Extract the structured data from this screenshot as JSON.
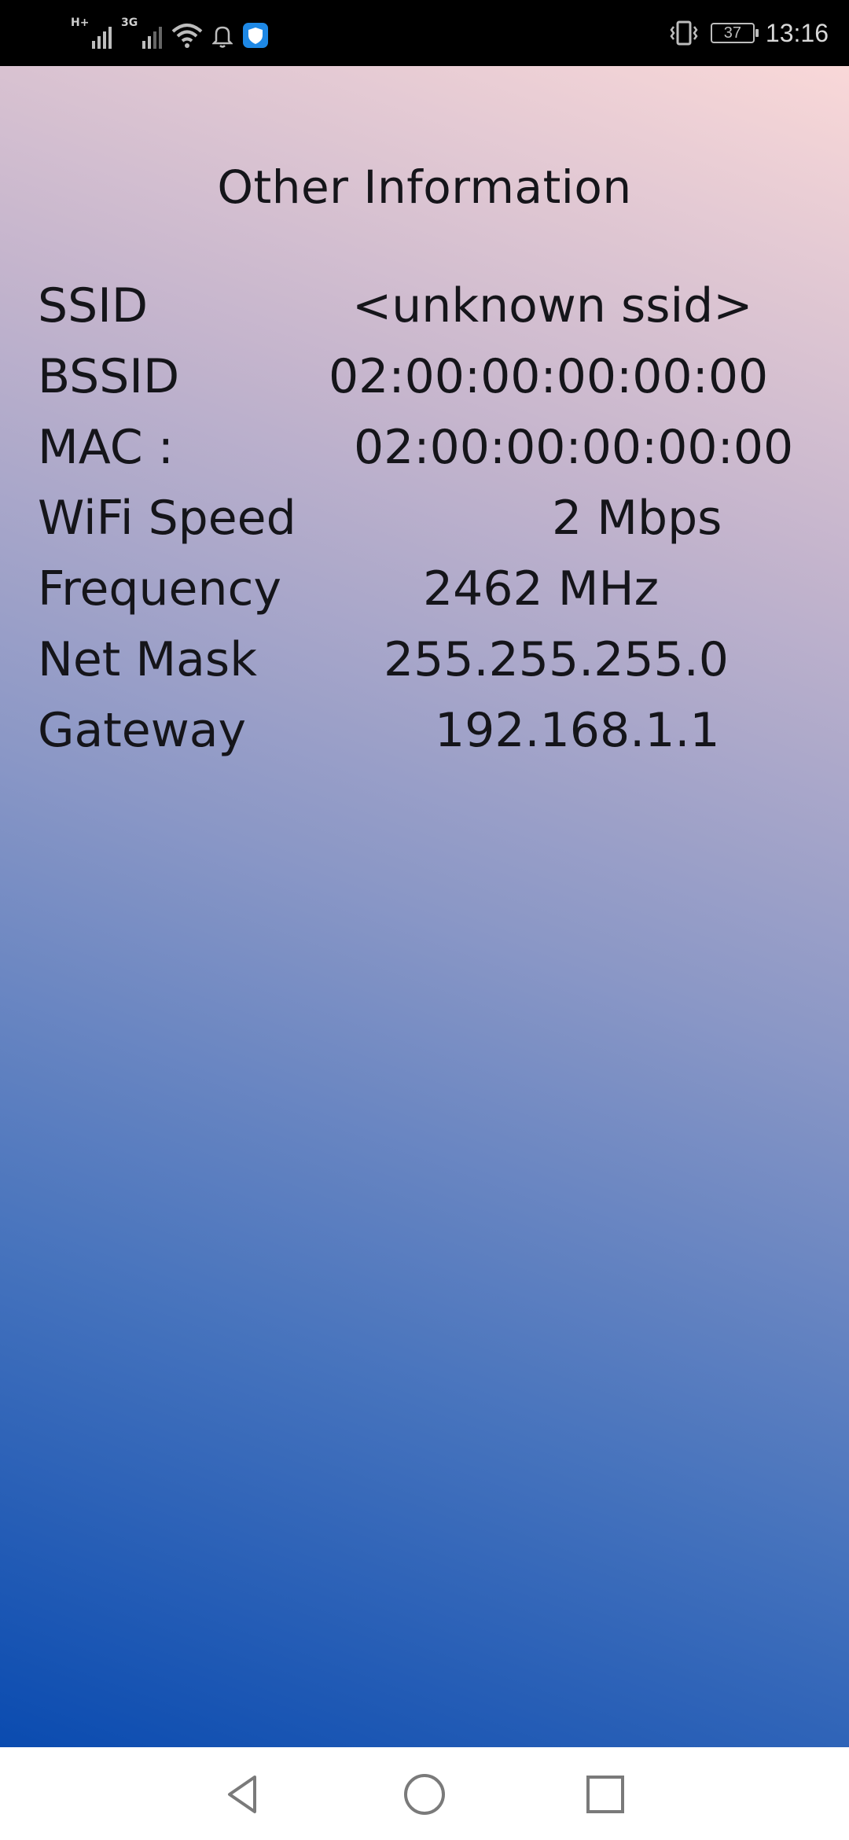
{
  "status_bar": {
    "signal1_type": "H+",
    "signal2_type": "3G",
    "battery_level": "37",
    "time": "13:16",
    "icons": [
      "signal-icon",
      "signal-icon",
      "wifi-icon",
      "bell-icon",
      "shield-app-icon",
      "vibrate-icon",
      "battery-icon"
    ]
  },
  "screen": {
    "title": "Other Information",
    "rows": [
      {
        "label": "SSID",
        "value": "<unknown ssid>"
      },
      {
        "label": "BSSID",
        "value": "02:00:00:00:00:00"
      },
      {
        "label": "MAC :",
        "value": "02:00:00:00:00:00"
      },
      {
        "label": "WiFi Speed",
        "value": "2 Mbps"
      },
      {
        "label": "Frequency",
        "value": "2462 MHz"
      },
      {
        "label": "Net Mask",
        "value": "255.255.255.0"
      },
      {
        "label": "Gateway",
        "value": "192.168.1.1"
      }
    ]
  },
  "nav_bar": {
    "buttons": [
      "back-icon",
      "home-icon",
      "recents-icon"
    ]
  },
  "colors": {
    "gradient_top_right": "#f9d8d8",
    "gradient_bottom_left": "#0a4bb0",
    "text": "#15151a"
  }
}
